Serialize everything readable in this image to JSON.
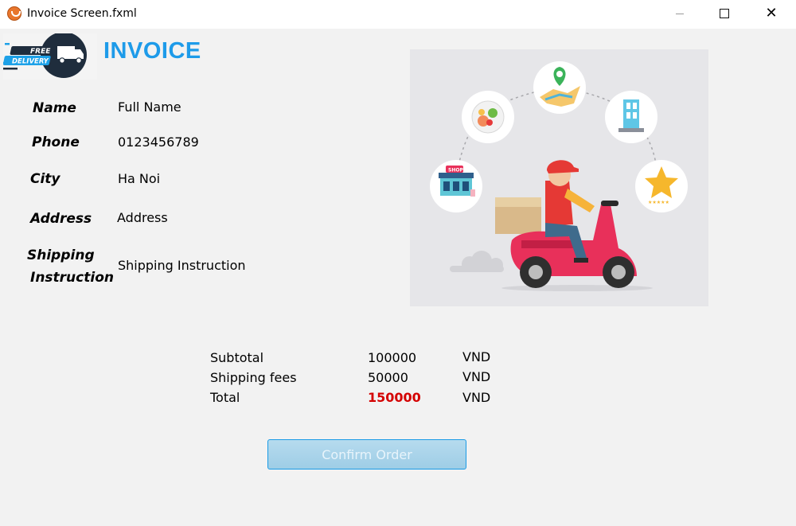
{
  "window": {
    "title": "Invoice Screen.fxml"
  },
  "header": {
    "logo_line1": "FREE",
    "logo_line2": "DELIVERY",
    "title": "INVOICE"
  },
  "form": {
    "name": {
      "label": "Name",
      "value": "Full Name"
    },
    "phone": {
      "label": "Phone",
      "value": "0123456789"
    },
    "city": {
      "label": "City",
      "value": "Ha Noi"
    },
    "address": {
      "label": "Address",
      "value": "Address"
    },
    "shipping": {
      "label_line1": "Shipping",
      "label_line2": "Instruction",
      "value": "Shipping Instruction"
    }
  },
  "illustration": {
    "shop_sign": "SHOP"
  },
  "summary": {
    "subtotal": {
      "label": "Subtotal",
      "value": "100000",
      "currency": "VND"
    },
    "shipping_fees": {
      "label": "Shipping fees",
      "value": "50000",
      "currency": "VND"
    },
    "total": {
      "label": "Total",
      "value": "150000",
      "currency": "VND"
    }
  },
  "actions": {
    "confirm_label": "Confirm Order"
  },
  "colors": {
    "accent": "#1e9be9",
    "total": "#d40000",
    "button": "#a6d3ea"
  }
}
